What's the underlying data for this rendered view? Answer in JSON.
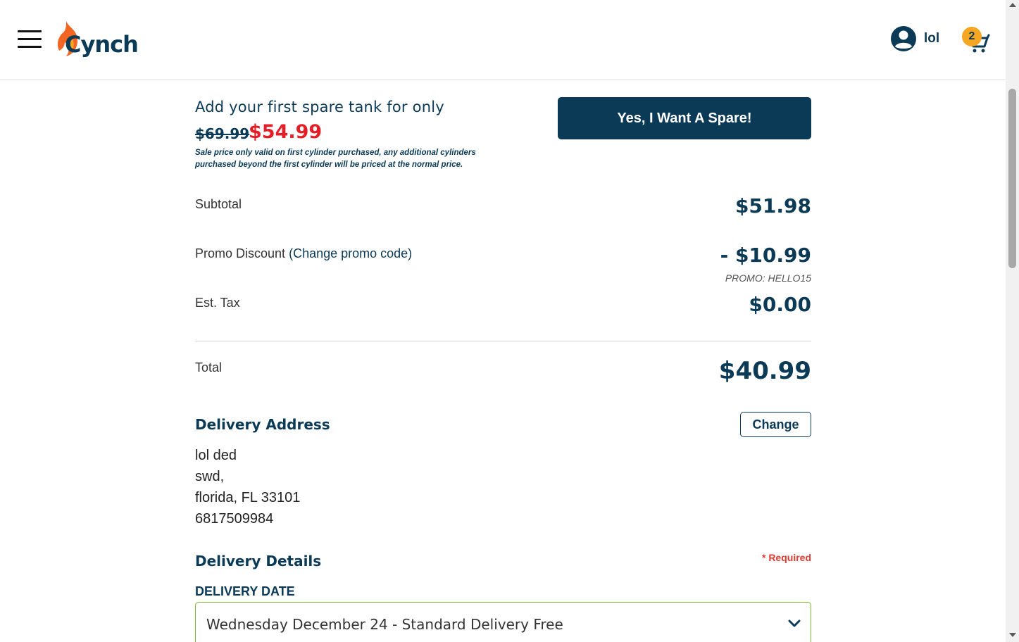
{
  "header": {
    "brand": "Cynch",
    "user_name": "lol",
    "cart_count": "2"
  },
  "spare_offer": {
    "title": "Add your first spare tank for only",
    "old_price": "$69.99",
    "new_price": "$54.99",
    "fine_print": "Sale price only valid on first cylinder purchased, any additional cylinders purchased beyond the first cylinder will be priced at the normal price.",
    "button_label": "Yes, I Want A Spare!"
  },
  "summary": {
    "subtotal_label": "Subtotal",
    "subtotal_value": "$51.98",
    "promo_label": "Promo Discount",
    "promo_link": "(Change promo code)",
    "promo_value": "- $10.99",
    "promo_code": "PROMO: HELLO15",
    "tax_label": "Est. Tax",
    "tax_value": "$0.00",
    "total_label": "Total",
    "total_value": "$40.99"
  },
  "delivery_address": {
    "title": "Delivery Address",
    "change_label": "Change",
    "lines": [
      "lol ded",
      "swd,",
      "florida, FL 33101",
      "6817509984"
    ]
  },
  "delivery_details": {
    "title": "Delivery Details",
    "required_text": "* Required",
    "date_label": "DELIVERY DATE",
    "date_value": "Wednesday December 24 - Standard Delivery Free"
  },
  "colors": {
    "brand_navy": "#0b3a57",
    "sale_red": "#e41e26",
    "badge_orange": "#f5a623",
    "flame_orange": "#f26522",
    "select_border_green": "#7cb82f"
  },
  "icons": [
    "hamburger-menu-icon",
    "flame-logo-icon",
    "user-avatar-icon",
    "cart-icon",
    "chevron-down-icon"
  ]
}
